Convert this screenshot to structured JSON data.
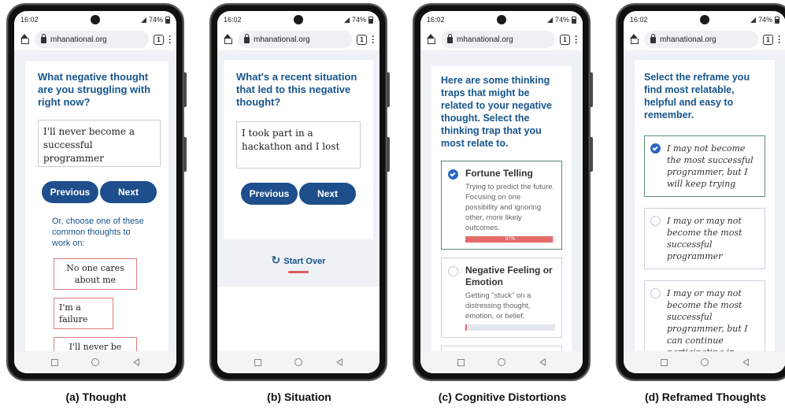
{
  "status": {
    "time": "16:02",
    "battery": "74%"
  },
  "browser": {
    "url": "mhanational.org",
    "tabs": "1"
  },
  "panels": {
    "thought": {
      "heading": "What negative thought are you struggling with right now?",
      "input_value": "I'll never become a successful programmer",
      "previous": "Previous",
      "next": "Next",
      "choose_text": "Or, choose one of these common thoughts to work on:",
      "options": [
        "No one cares about me",
        "I'm a failure",
        "I'll never be able to do anything"
      ],
      "caption": "(a) Thought"
    },
    "situation": {
      "heading": "What's a recent situation that led to this negative thought?",
      "input_value": "I took part in a hackathon and I lost",
      "previous": "Previous",
      "next": "Next",
      "start_over": "Start Over",
      "caption": "(b) Situation"
    },
    "distortions": {
      "heading": "Here are some thinking traps that might be related to your negative thought. Select the thinking trap that you most relate to.",
      "traps": [
        {
          "name": "Fortune Telling",
          "description": "Trying to predict the future. Focusing on one possibility and ignoring other, more likely outcomes.",
          "score_label": "97%",
          "score": 0.97,
          "selected": true
        },
        {
          "name": "Negative Feeling or Emotion",
          "description": "Getting \"stuck\" on a distressing thought, emotion, or belief.",
          "score_label": "",
          "score": 0.02,
          "selected": false
        }
      ],
      "caption": "(c) Cognitive Distortions"
    },
    "reframes": {
      "heading": "Select the reframe you find most relatable, helpful and easy to remember.",
      "items": [
        {
          "text": "I may not become the most successful programmer, but I will keep trying",
          "selected": true
        },
        {
          "text": "I may or may not become the most successful programmer",
          "selected": false
        },
        {
          "text": "I may or may not become the most successful programmer, but I can continue participating in",
          "selected": false
        }
      ],
      "caption": "(d) Reframed Thoughts"
    }
  },
  "colors": {
    "heading": "#17558c",
    "button": "#1e4e8c",
    "accent_red": "#e46a6a",
    "selected_radio": "#2a66c2"
  }
}
